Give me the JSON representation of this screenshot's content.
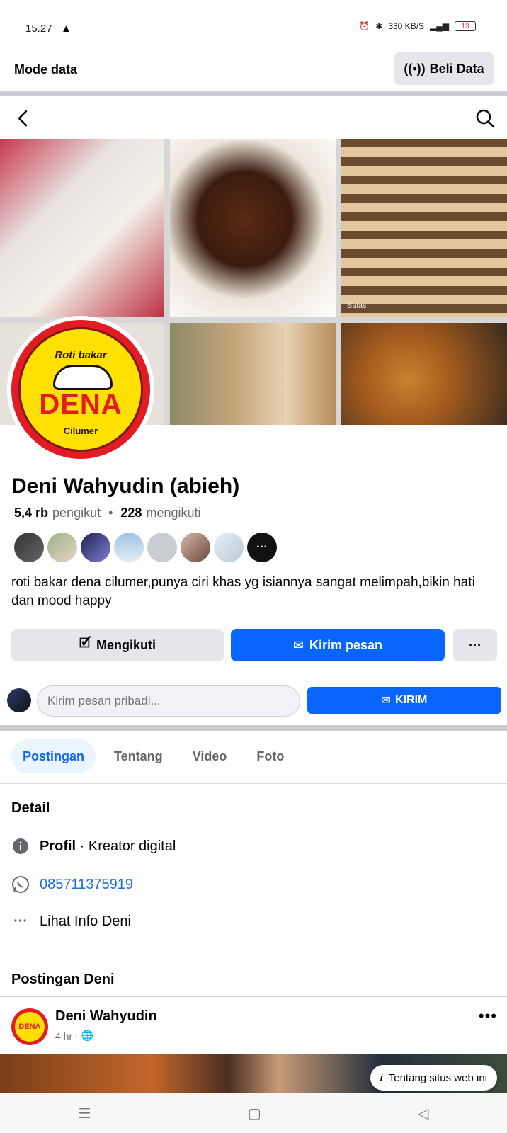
{
  "status": {
    "time": "15.27",
    "network_speed": "330 KB/S",
    "battery": "13"
  },
  "mode": {
    "label": "Mode data",
    "buy_button": "Beli Data"
  },
  "cover": {
    "caption": "Balas"
  },
  "profile": {
    "logo_top": "Roti bakar",
    "logo_main": "DENA",
    "logo_bottom": "Cilumer",
    "name": "Deni Wahyudin (abieh)",
    "followers_count": "5,4 rb",
    "followers_label": "pengikut",
    "following_count": "228",
    "following_label": "mengikuti",
    "bio": "roti bakar dena cilumer,punya ciri khas yg isiannya sangat melimpah,bikin hati dan mood happy"
  },
  "actions": {
    "follow": "Mengikuti",
    "message": "Kirim pesan",
    "more": "···"
  },
  "private_message": {
    "placeholder": "Kirim pesan pribadi...",
    "send": "KIRIM"
  },
  "tabs": [
    "Postingan",
    "Tentang",
    "Video",
    "Foto"
  ],
  "detail": {
    "title": "Detail",
    "profile_label": "Profil",
    "profile_type": "· Kreator digital",
    "phone": "085711375919",
    "more_info": "Lihat Info Deni"
  },
  "posts": {
    "title": "Postingan Deni",
    "author": "Deni Wahyudin",
    "time": "4 hr ·",
    "avatar_text": "DENA"
  },
  "about_chip": "Tentang situs web ini",
  "colors": {
    "accent": "#0866ff",
    "button_gray": "#e4e6eb",
    "link": "#1a6ed8"
  }
}
